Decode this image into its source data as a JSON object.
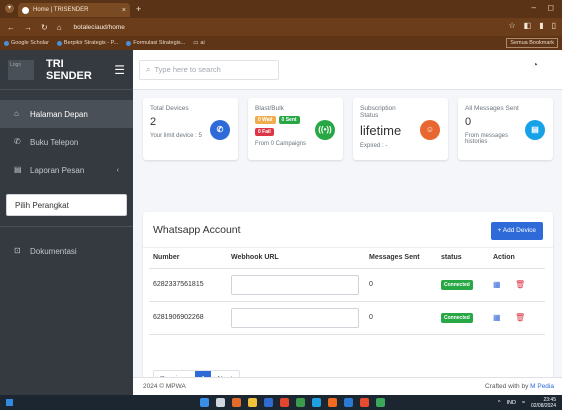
{
  "browser": {
    "tab_title": "Home | TRISENDER",
    "url": "botaleciaud/home",
    "bookmarks": [
      "Google Scholar",
      "Berpikir Strategis - P...",
      "Formulasi Strategis...",
      "ai"
    ],
    "bookmarks_right": "Semua Bookmark"
  },
  "sidebar": {
    "logo_text": "Logo",
    "brand": "TRI\nSENDER",
    "items": [
      {
        "label": "Halaman Depan",
        "icon": "home-icon"
      },
      {
        "label": "Buku Telepon",
        "icon": "phone-icon"
      },
      {
        "label": "Laporan Pesan",
        "icon": "report-icon"
      }
    ],
    "device_select": "Pilih Perangkat",
    "doc_item": "Dokumentasi"
  },
  "topnav": {
    "search_placeholder": "Type here to search"
  },
  "cards": {
    "total_devices": {
      "title": "Total Devices",
      "value": "2",
      "note": "Your limit device : 5"
    },
    "blast": {
      "title": "Blast/Bulk",
      "badges": [
        "0 Wait",
        "0 Sent",
        "0 Fail"
      ],
      "note": "From 0 Campaigns"
    },
    "subscription": {
      "title_line1": "Subscription",
      "title_line2": "Status",
      "value": "lifetime",
      "note": "Expired : -"
    },
    "all_messages": {
      "title": "All Messages Sent",
      "value": "0",
      "note_line1": "From messages",
      "note_line2": "histories"
    }
  },
  "account": {
    "title": "Whatsapp Account",
    "add_button": "+ Add Device",
    "columns": [
      "Number",
      "Webhook URL",
      "Messages Sent",
      "status",
      "Action"
    ],
    "rows": [
      {
        "number": "6282337561815",
        "webhook": "",
        "sent": "0",
        "status": "Connected"
      },
      {
        "number": "6281906902268",
        "webhook": "",
        "sent": "0",
        "status": "Connected"
      }
    ],
    "pager": {
      "prev": "Previous",
      "page": "1",
      "next": "Next"
    }
  },
  "footer": {
    "left": "2024 © MPWA",
    "right_text": "Crafted with by",
    "right_link": "M Pedia"
  },
  "taskbar": {
    "time": "23:45",
    "date": "02/08/2024",
    "lang": "IND"
  },
  "colors": {
    "sidebar": "#343a40",
    "primary": "#2e6bd8",
    "success": "#28a745",
    "danger": "#dc3545",
    "titlebar": "#5a3316"
  }
}
